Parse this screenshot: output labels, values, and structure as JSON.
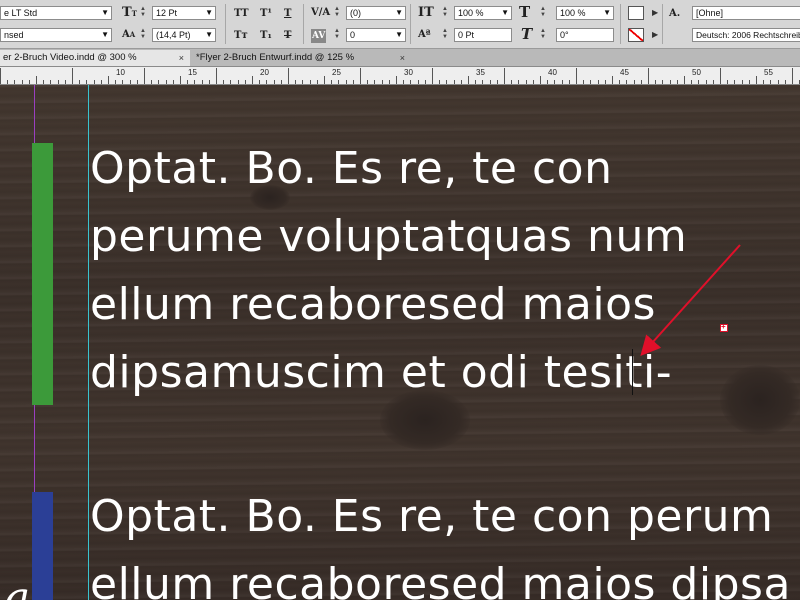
{
  "control_panel": {
    "font_family": "e LT Std",
    "font_style": "nsed",
    "font_size": "12 Pt",
    "leading": "(14,4 Pt)",
    "tracking": "(0)",
    "kerning": "0",
    "vertical_scale": "100 %",
    "horizontal_scale": "100 %",
    "baseline_shift": "0 Pt",
    "skew": "0°",
    "char_style": "[Ohne]",
    "language": "Deutsch: 2006 Rechtschreib",
    "icons": {
      "font_size_icon": "font-size-icon",
      "leading_icon": "leading-icon",
      "all_caps": "TT",
      "superscript": "T¹",
      "underline": "T",
      "small_caps": "Tт",
      "subscript": "T₁",
      "strikethrough": "T",
      "tracking_icon": "tracking-icon",
      "kerning_icon": "AV",
      "vscale_icon": "IT",
      "baseline_icon": "Aª",
      "hscale_icon": "T",
      "skew_icon": "T",
      "char_style_icon": "A."
    }
  },
  "tabs": [
    {
      "label": "er 2-Bruch Video.indd @ 300 %",
      "active": true
    },
    {
      "label": "*Flyer 2-Bruch Entwurf.indd @ 125 %",
      "active": false
    }
  ],
  "ruler": {
    "labels": [
      "10",
      "15",
      "20",
      "25",
      "30",
      "35",
      "40",
      "45",
      "50",
      "55"
    ]
  },
  "document": {
    "paragraph1": [
      "Optat. Bo. Es re, te con",
      "perume voluptatquas num",
      "ellum recaboresed maios",
      "dipsamuscim et odi tesiti-"
    ],
    "paragraph2": [
      "Optat. Bo. Es re, te con perum",
      "ellum recaboresed maios dipsa"
    ],
    "brand_glyph": "a",
    "colors": {
      "green_bar": "#3c9a3a",
      "blue_bar": "#2b3f96",
      "annotation_arrow": "#e0102a",
      "margin_guide": "#9a3fc0",
      "column_guide": "#39c3cf"
    }
  }
}
